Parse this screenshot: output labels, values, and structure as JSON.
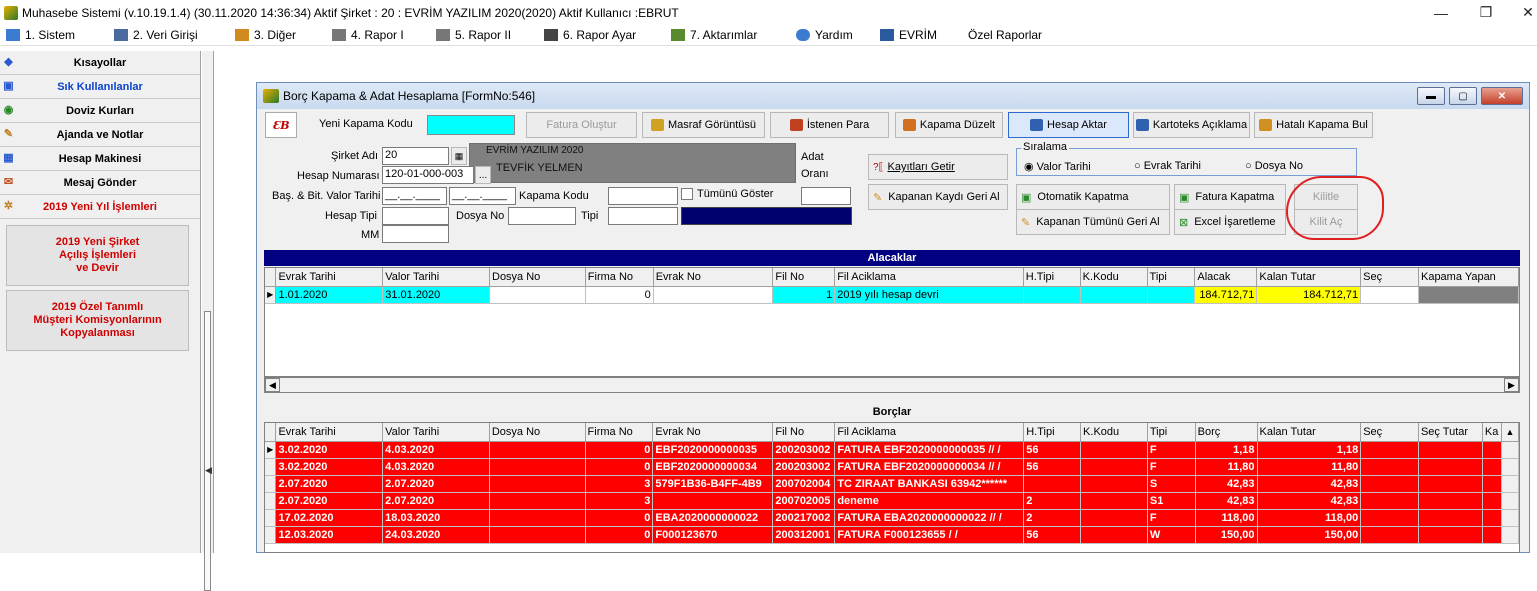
{
  "window": {
    "title": "Muhasebe Sistemi (v.10.19.1.4) (30.11.2020 14:36:34) Aktif Şirket : 20 : EVRİM YAZILIM  2020(2020) Aktif Kullanıcı :EBRUT",
    "minimize": "—",
    "restore": "❐",
    "close": "✕"
  },
  "menu": [
    {
      "label": "1.  Sistem",
      "icon": "system-icon",
      "color": "#3b7bd0"
    },
    {
      "label": "2.  Veri Girişi",
      "icon": "data-entry-icon",
      "color": "#4a6aa0"
    },
    {
      "label": "3.  Diğer",
      "icon": "other-icon",
      "color": "#d08a20"
    },
    {
      "label": "4.  Rapor I",
      "icon": "printer-icon",
      "color": "#555555"
    },
    {
      "label": "5.  Rapor II",
      "icon": "printer-icon",
      "color": "#555555"
    },
    {
      "label": "6.  Rapor Ayar",
      "icon": "report-settings-icon",
      "color": "#444444"
    },
    {
      "label": "7.  Aktarımlar",
      "icon": "transfer-icon",
      "color": "#5a8a30"
    },
    {
      "label": "Yardım",
      "icon": "help-icon",
      "color": "#3b7bd0"
    },
    {
      "label": "EVRİM",
      "icon": "evrim-icon",
      "color": "#2a5aa0"
    },
    {
      "label": "Özel Raporlar",
      "icon": "",
      "color": ""
    }
  ],
  "sidebar": {
    "items": [
      {
        "label": "Kısayollar",
        "icon": "shortcut-icon",
        "style": "normal"
      },
      {
        "label": "Sık Kullanılanlar",
        "icon": "favorites-icon",
        "style": "blue"
      },
      {
        "label": "Doviz Kurları",
        "icon": "currency-icon",
        "style": "normal"
      },
      {
        "label": "Ajanda ve Notlar",
        "icon": "agenda-icon",
        "style": "normal"
      },
      {
        "label": "Hesap Makinesi",
        "icon": "calculator-icon",
        "style": "normal"
      },
      {
        "label": "Mesaj Gönder",
        "icon": "message-icon",
        "style": "normal"
      },
      {
        "label": "2019 Yeni Yıl İşlemleri",
        "icon": "new-year-icon",
        "style": "red"
      }
    ],
    "big_buttons": [
      "2019 Yeni Şirket\nAçılış İşlemleri\nve Devir",
      "2019 Özel Tanımlı\nMüşteri Komisyonlarının\nKopyalanması"
    ]
  },
  "form": {
    "title": "Borç Kapama & Adat Hesaplama [FormNo:546]",
    "logo": "ƐB",
    "new_code_label": "Yeni Kapama Kodu",
    "toolbar": [
      {
        "label": "Fatura Oluştur",
        "disabled": true,
        "icon": ""
      },
      {
        "label": "Masraf Görüntüsü",
        "icon": "expense-icon"
      },
      {
        "label": "İstenen Para",
        "icon": "requested-money-icon"
      },
      {
        "label": "Kapama Düzelt",
        "icon": "edit-closing-icon"
      },
      {
        "label": "Hesap Aktar",
        "icon": "transfer-account-icon",
        "active": true
      },
      {
        "label": "Kartoteks Açıklama",
        "icon": "card-note-icon"
      },
      {
        "label": "Hatalı Kapama Bul",
        "icon": "find-error-icon"
      }
    ],
    "fields": {
      "company_label": "Şirket Adı",
      "company_code": "20",
      "company_name": "EVRİM YAZILIM  2020",
      "account_label": "Hesap Numarası",
      "account_no": "120-01-000-003",
      "account_name": "TEVFİK YELMEN",
      "date_label": "Baş. & Bit. Valor Tarihi",
      "date_start": "__.__.____",
      "date_end": "__.__.____",
      "closing_code_label": "Kapama Kodu",
      "show_all_label": "Tümünü Göster",
      "account_type_label": "Hesap Tipi",
      "file_no_label": "Dosya No",
      "type_label": "Tipi",
      "mm_label": "MM",
      "adat_label": "Adat",
      "rate_label": "Oranı",
      "browse": "..."
    },
    "actions": {
      "get_records": "Kayıtları Getir",
      "undo_closed": "Kapanan Kaydı Geri Al",
      "auto_close": "Otomatik Kapatma",
      "undo_all_closed": "Kapanan Tümünü Geri Al",
      "invoice_close": "Fatura Kapatma",
      "excel_mark": "Excel İşaretleme",
      "lock": "Kilitle",
      "unlock": "Kilit Aç"
    },
    "sort": {
      "label": "Sıralama",
      "options": [
        "Valor Tarihi",
        "Evrak Tarihi",
        "Dosya No"
      ],
      "selected": "Valor Tarihi"
    },
    "receivables": {
      "title": "Alacaklar",
      "columns": [
        "Evrak Tarihi",
        "Valor Tarihi",
        "Dosya No",
        "Firma No",
        "Evrak No",
        "Fil No",
        "Fil Aciklama",
        "H.Tipi",
        "K.Kodu",
        "Tipi",
        "Alacak",
        "Kalan Tutar",
        "Seç",
        "Kapama Yapan"
      ],
      "rows": [
        [
          "1.01.2020",
          "31.01.2020",
          "",
          "0",
          "",
          "1",
          "2019 yılı hesap devri",
          "",
          "",
          "",
          "184.712,71",
          "184.712,71",
          "",
          ""
        ]
      ]
    },
    "debts": {
      "title": "Borçlar",
      "columns": [
        "Evrak Tarihi",
        "Valor Tarihi",
        "Dosya No",
        "Firma No",
        "Evrak No",
        "Fil No",
        "Fil Aciklama",
        "H.Tipi",
        "K.Kodu",
        "Tipi",
        "Borç",
        "Kalan Tutar",
        "Seç",
        "Seç Tutar",
        "Ka"
      ],
      "rows": [
        [
          "3.02.2020",
          "4.03.2020",
          "",
          "0",
          "EBF2020000000035",
          "200203002",
          "FATURA EBF2020000000035 // /",
          "56",
          "",
          "F",
          "1,18",
          "1,18",
          "",
          "",
          ""
        ],
        [
          "3.02.2020",
          "4.03.2020",
          "",
          "0",
          "EBF2020000000034",
          "200203002",
          "FATURA EBF2020000000034 // /",
          "56",
          "",
          "F",
          "11,80",
          "11,80",
          "",
          "",
          ""
        ],
        [
          "2.07.2020",
          "2.07.2020",
          "",
          "3",
          "579F1B36-B4FF-4B9",
          "200702004",
          "TC ZIRAAT BANKASI 63942******",
          "",
          "",
          "S",
          "42,83",
          "42,83",
          "",
          "",
          ""
        ],
        [
          "2.07.2020",
          "2.07.2020",
          "",
          "3",
          "",
          "200702005",
          "deneme",
          "2",
          "",
          "S1",
          "42,83",
          "42,83",
          "",
          "",
          ""
        ],
        [
          "17.02.2020",
          "18.03.2020",
          "",
          "0",
          "EBA2020000000022",
          "200217002",
          "FATURA EBA2020000000022 // /",
          "2",
          "",
          "F",
          "118,00",
          "118,00",
          "",
          "",
          ""
        ],
        [
          "12.03.2020",
          "24.03.2020",
          "",
          "0",
          "F000123670",
          "200312001",
          "FATURA F000123655 / /",
          "56",
          "",
          "W",
          "150,00",
          "150,00",
          "",
          "",
          ""
        ]
      ]
    }
  },
  "colors": {
    "receivable_row": "#00ffff",
    "receivable_amount": "#ffff00",
    "debt_row": "#ff0000",
    "grid_header_bar": "#000080",
    "annotation": "#e02020"
  }
}
